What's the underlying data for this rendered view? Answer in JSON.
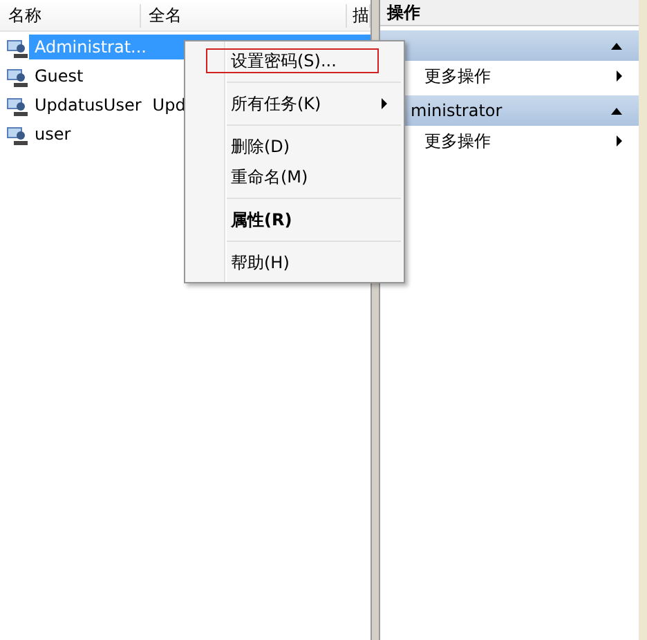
{
  "list": {
    "columns": [
      "名称",
      "全名",
      "描"
    ],
    "rows": [
      {
        "name": "Administrat...",
        "full_name": "",
        "selected": true
      },
      {
        "name": "Guest",
        "full_name": "",
        "selected": false
      },
      {
        "name": "UpdatusUser",
        "full_name": "Upd",
        "selected": false
      },
      {
        "name": "user",
        "full_name": "",
        "selected": false
      }
    ]
  },
  "actions": {
    "title": "操作",
    "groups": [
      {
        "items": [
          {
            "label": "更多操作"
          }
        ]
      },
      {
        "title": "ministrator",
        "items": [
          {
            "label": "更多操作"
          }
        ]
      }
    ]
  },
  "context_menu": {
    "items": [
      {
        "label": "设置密码(S)...",
        "selected": true,
        "default": false,
        "submenu": false,
        "separator_after": true
      },
      {
        "label": "所有任务(K)",
        "selected": false,
        "default": false,
        "submenu": true,
        "separator_after": true
      },
      {
        "label": "删除(D)",
        "selected": false,
        "default": false,
        "submenu": false,
        "separator_after": false
      },
      {
        "label": "重命名(M)",
        "selected": false,
        "default": false,
        "submenu": false,
        "separator_after": true
      },
      {
        "label": "属性(R)",
        "selected": false,
        "default": true,
        "submenu": false,
        "separator_after": true
      },
      {
        "label": "帮助(H)",
        "selected": false,
        "default": false,
        "submenu": false,
        "separator_after": false
      }
    ]
  }
}
